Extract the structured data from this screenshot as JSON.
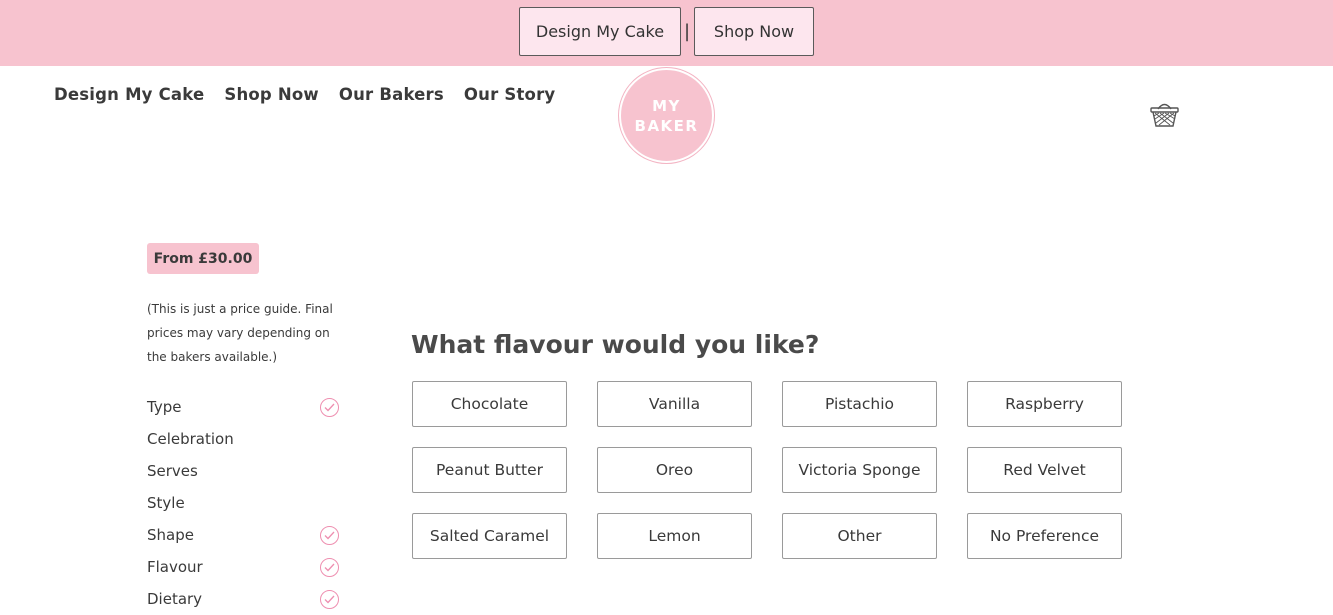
{
  "topbar": {
    "design_label": "Design My Cake",
    "separator": "|",
    "shop_label": "Shop Now"
  },
  "nav": {
    "items": [
      "Design My Cake",
      "Shop Now",
      "Our Bakers",
      "Our Story"
    ]
  },
  "logo": {
    "line1": "MY",
    "line2": "BAKER"
  },
  "cart": {
    "icon": "basket-icon"
  },
  "price": {
    "label": "From £30.00",
    "guide": "(This is just a price guide. Final prices may vary depending on the bakers available.)"
  },
  "steps": [
    {
      "label": "Type",
      "completed": true
    },
    {
      "label": "Celebration",
      "completed": false
    },
    {
      "label": "Serves",
      "completed": false
    },
    {
      "label": "Style",
      "completed": false
    },
    {
      "label": "Shape",
      "completed": true
    },
    {
      "label": "Flavour",
      "completed": true
    },
    {
      "label": "Dietary",
      "completed": true
    }
  ],
  "question": "What flavour would you like?",
  "options": [
    "Chocolate",
    "Vanilla",
    "Pistachio",
    "Raspberry",
    "Peanut Butter",
    "Oreo",
    "Victoria Sponge",
    "Red Velvet",
    "Salted Caramel",
    "Lemon",
    "Other",
    "No Preference"
  ],
  "colors": {
    "brand_pink": "#f7c3cf",
    "button_pink": "#fde6ee",
    "check_pink": "#ee8fb0",
    "text": "#3a3a3a"
  }
}
